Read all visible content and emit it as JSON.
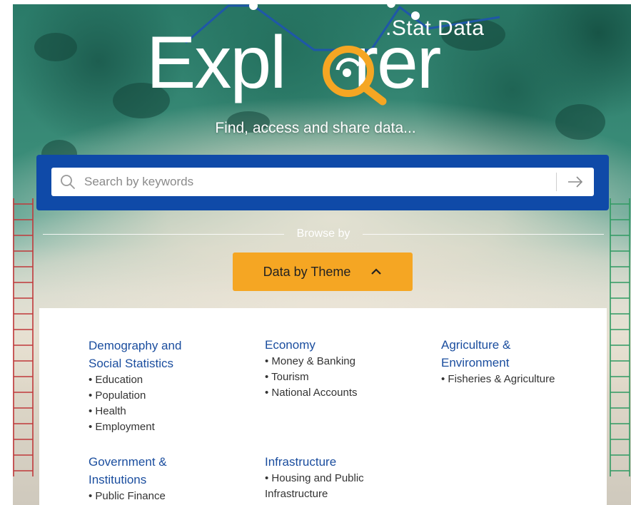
{
  "logo": {
    "stat_text": ".Stat Data",
    "word_left": "Expl",
    "word_right": "rer"
  },
  "tagline": "Find, access and share data...",
  "search": {
    "placeholder": "Search by keywords",
    "value": ""
  },
  "browse": {
    "label": "Browse by",
    "theme_button_label": "Data by Theme"
  },
  "themes": [
    {
      "title_lines": [
        "Demography and",
        "Social Statistics"
      ],
      "items": [
        "• Education",
        "• Population",
        "• Health",
        "• Employment"
      ]
    },
    {
      "title_lines": [
        "Economy"
      ],
      "items": [
        "• Money & Banking",
        "• Tourism",
        "• National Accounts"
      ]
    },
    {
      "title_lines": [
        "Agriculture &",
        "Environment"
      ],
      "items": [
        "• Fisheries & Agriculture"
      ]
    },
    {
      "title_lines": [
        "Government &",
        "Institutions"
      ],
      "items": [
        "• Public Finance"
      ]
    },
    {
      "title_lines": [
        "Infrastructure"
      ],
      "items": [
        "• Housing and Public",
        "Infrastructure"
      ]
    }
  ],
  "colors": {
    "search_band": "#0f4aa8",
    "accent_orange": "#f5a623",
    "link_blue": "#1a4d9e"
  },
  "icons": {
    "search": "search-icon",
    "submit": "arrow-right-icon",
    "collapse": "chevron-up-icon"
  }
}
